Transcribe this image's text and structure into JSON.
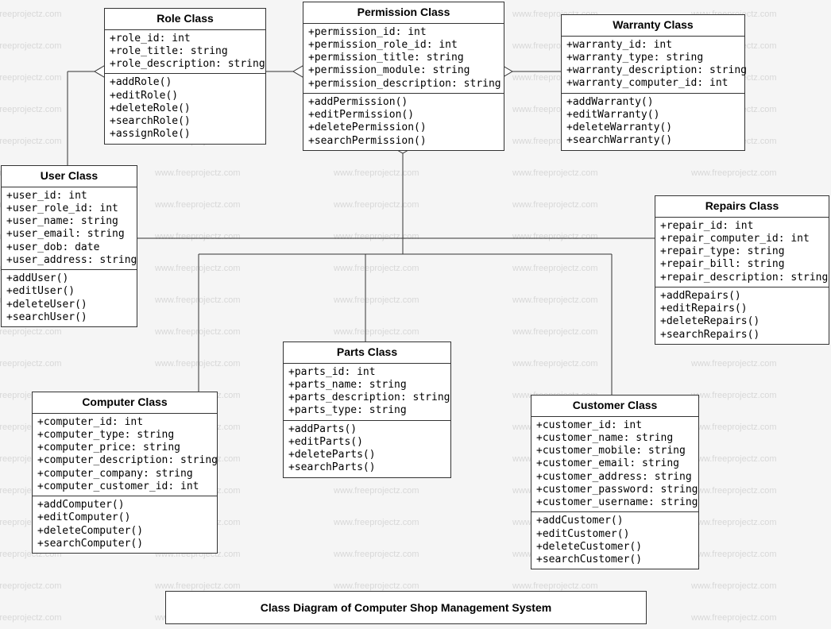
{
  "title": "Class Diagram of Computer Shop Management System",
  "watermark_text": "www.freeprojectz.com",
  "classes": {
    "role": {
      "name": "Role Class",
      "attributes": [
        "+role_id: int",
        "+role_title: string",
        "+role_description: string"
      ],
      "methods": [
        "+addRole()",
        "+editRole()",
        "+deleteRole()",
        "+searchRole()",
        "+assignRole()"
      ]
    },
    "permission": {
      "name": "Permission Class",
      "attributes": [
        "+permission_id: int",
        "+permission_role_id: int",
        "+permission_title: string",
        "+permission_module: string",
        "+permission_description: string"
      ],
      "methods": [
        "+addPermission()",
        "+editPermission()",
        "+deletePermission()",
        "+searchPermission()"
      ]
    },
    "warranty": {
      "name": "Warranty Class",
      "attributes": [
        "+warranty_id: int",
        "+warranty_type: string",
        "+warranty_description: string",
        "+warranty_computer_id: int"
      ],
      "methods": [
        "+addWarranty()",
        "+editWarranty()",
        "+deleteWarranty()",
        "+searchWarranty()"
      ]
    },
    "user": {
      "name": "User Class",
      "attributes": [
        "+user_id: int",
        "+user_role_id: int",
        "+user_name: string",
        "+user_email: string",
        "+user_dob: date",
        "+user_address: string"
      ],
      "methods": [
        "+addUser()",
        "+editUser()",
        "+deleteUser()",
        "+searchUser()"
      ]
    },
    "repairs": {
      "name": "Repairs Class",
      "attributes": [
        "+repair_id: int",
        "+repair_computer_id: int",
        "+repair_type: string",
        "+repair_bill: string",
        "+repair_description: string"
      ],
      "methods": [
        "+addRepairs()",
        "+editRepairs()",
        "+deleteRepairs()",
        "+searchRepairs()"
      ]
    },
    "parts": {
      "name": "Parts Class",
      "attributes": [
        "+parts_id: int",
        "+parts_name: string",
        "+parts_description: string",
        "+parts_type: string"
      ],
      "methods": [
        "+addParts()",
        "+editParts()",
        "+deleteParts()",
        "+searchParts()"
      ]
    },
    "computer": {
      "name": "Computer Class",
      "attributes": [
        "+computer_id: int",
        "+computer_type: string",
        "+computer_price: string",
        "+computer_description: string",
        "+computer_company: string",
        "+computer_customer_id: int"
      ],
      "methods": [
        "+addComputer()",
        "+editComputer()",
        "+deleteComputer()",
        "+searchComputer()"
      ]
    },
    "customer": {
      "name": "Customer Class",
      "attributes": [
        "+customer_id: int",
        "+customer_name: string",
        "+customer_mobile: string",
        "+customer_email: string",
        "+customer_address: string",
        "+customer_password: string",
        "+customer_username: string"
      ],
      "methods": [
        "+addCustomer()",
        "+editCustomer()",
        "+deleteCustomer()",
        "+searchCustomer()"
      ]
    }
  }
}
